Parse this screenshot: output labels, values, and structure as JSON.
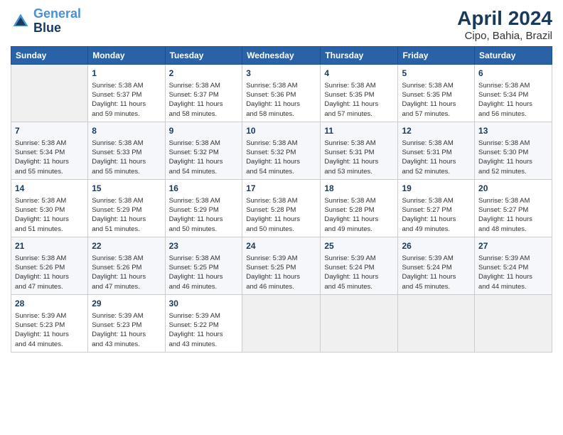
{
  "header": {
    "logo_line1": "General",
    "logo_line2": "Blue",
    "month_year": "April 2024",
    "location": "Cipo, Bahia, Brazil"
  },
  "columns": [
    "Sunday",
    "Monday",
    "Tuesday",
    "Wednesday",
    "Thursday",
    "Friday",
    "Saturday"
  ],
  "weeks": [
    [
      {
        "day": "",
        "info": ""
      },
      {
        "day": "1",
        "info": "Sunrise: 5:38 AM\nSunset: 5:37 PM\nDaylight: 11 hours\nand 59 minutes."
      },
      {
        "day": "2",
        "info": "Sunrise: 5:38 AM\nSunset: 5:37 PM\nDaylight: 11 hours\nand 58 minutes."
      },
      {
        "day": "3",
        "info": "Sunrise: 5:38 AM\nSunset: 5:36 PM\nDaylight: 11 hours\nand 58 minutes."
      },
      {
        "day": "4",
        "info": "Sunrise: 5:38 AM\nSunset: 5:35 PM\nDaylight: 11 hours\nand 57 minutes."
      },
      {
        "day": "5",
        "info": "Sunrise: 5:38 AM\nSunset: 5:35 PM\nDaylight: 11 hours\nand 57 minutes."
      },
      {
        "day": "6",
        "info": "Sunrise: 5:38 AM\nSunset: 5:34 PM\nDaylight: 11 hours\nand 56 minutes."
      }
    ],
    [
      {
        "day": "7",
        "info": "Sunrise: 5:38 AM\nSunset: 5:34 PM\nDaylight: 11 hours\nand 55 minutes."
      },
      {
        "day": "8",
        "info": "Sunrise: 5:38 AM\nSunset: 5:33 PM\nDaylight: 11 hours\nand 55 minutes."
      },
      {
        "day": "9",
        "info": "Sunrise: 5:38 AM\nSunset: 5:32 PM\nDaylight: 11 hours\nand 54 minutes."
      },
      {
        "day": "10",
        "info": "Sunrise: 5:38 AM\nSunset: 5:32 PM\nDaylight: 11 hours\nand 54 minutes."
      },
      {
        "day": "11",
        "info": "Sunrise: 5:38 AM\nSunset: 5:31 PM\nDaylight: 11 hours\nand 53 minutes."
      },
      {
        "day": "12",
        "info": "Sunrise: 5:38 AM\nSunset: 5:31 PM\nDaylight: 11 hours\nand 52 minutes."
      },
      {
        "day": "13",
        "info": "Sunrise: 5:38 AM\nSunset: 5:30 PM\nDaylight: 11 hours\nand 52 minutes."
      }
    ],
    [
      {
        "day": "14",
        "info": "Sunrise: 5:38 AM\nSunset: 5:30 PM\nDaylight: 11 hours\nand 51 minutes."
      },
      {
        "day": "15",
        "info": "Sunrise: 5:38 AM\nSunset: 5:29 PM\nDaylight: 11 hours\nand 51 minutes."
      },
      {
        "day": "16",
        "info": "Sunrise: 5:38 AM\nSunset: 5:29 PM\nDaylight: 11 hours\nand 50 minutes."
      },
      {
        "day": "17",
        "info": "Sunrise: 5:38 AM\nSunset: 5:28 PM\nDaylight: 11 hours\nand 50 minutes."
      },
      {
        "day": "18",
        "info": "Sunrise: 5:38 AM\nSunset: 5:28 PM\nDaylight: 11 hours\nand 49 minutes."
      },
      {
        "day": "19",
        "info": "Sunrise: 5:38 AM\nSunset: 5:27 PM\nDaylight: 11 hours\nand 49 minutes."
      },
      {
        "day": "20",
        "info": "Sunrise: 5:38 AM\nSunset: 5:27 PM\nDaylight: 11 hours\nand 48 minutes."
      }
    ],
    [
      {
        "day": "21",
        "info": "Sunrise: 5:38 AM\nSunset: 5:26 PM\nDaylight: 11 hours\nand 47 minutes."
      },
      {
        "day": "22",
        "info": "Sunrise: 5:38 AM\nSunset: 5:26 PM\nDaylight: 11 hours\nand 47 minutes."
      },
      {
        "day": "23",
        "info": "Sunrise: 5:38 AM\nSunset: 5:25 PM\nDaylight: 11 hours\nand 46 minutes."
      },
      {
        "day": "24",
        "info": "Sunrise: 5:39 AM\nSunset: 5:25 PM\nDaylight: 11 hours\nand 46 minutes."
      },
      {
        "day": "25",
        "info": "Sunrise: 5:39 AM\nSunset: 5:24 PM\nDaylight: 11 hours\nand 45 minutes."
      },
      {
        "day": "26",
        "info": "Sunrise: 5:39 AM\nSunset: 5:24 PM\nDaylight: 11 hours\nand 45 minutes."
      },
      {
        "day": "27",
        "info": "Sunrise: 5:39 AM\nSunset: 5:24 PM\nDaylight: 11 hours\nand 44 minutes."
      }
    ],
    [
      {
        "day": "28",
        "info": "Sunrise: 5:39 AM\nSunset: 5:23 PM\nDaylight: 11 hours\nand 44 minutes."
      },
      {
        "day": "29",
        "info": "Sunrise: 5:39 AM\nSunset: 5:23 PM\nDaylight: 11 hours\nand 43 minutes."
      },
      {
        "day": "30",
        "info": "Sunrise: 5:39 AM\nSunset: 5:22 PM\nDaylight: 11 hours\nand 43 minutes."
      },
      {
        "day": "",
        "info": ""
      },
      {
        "day": "",
        "info": ""
      },
      {
        "day": "",
        "info": ""
      },
      {
        "day": "",
        "info": ""
      }
    ]
  ]
}
